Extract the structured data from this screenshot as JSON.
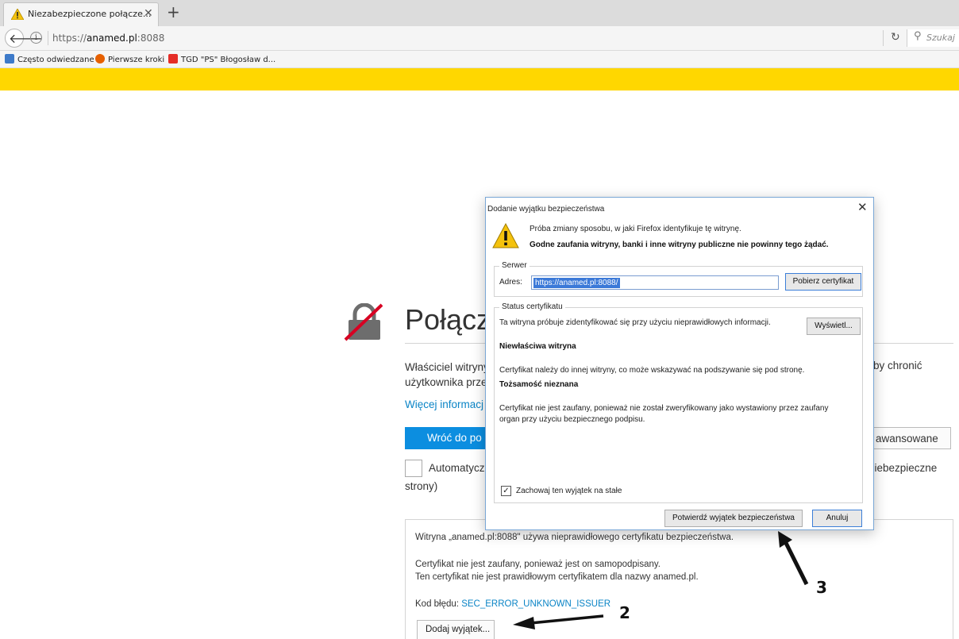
{
  "tab": {
    "title": "Niezabezpieczone połącze..."
  },
  "navbar": {
    "url_prefix": "https://",
    "url_host": "anamed.pl",
    "url_port": ":8088",
    "search_placeholder": "Szukaj"
  },
  "bookmarks": [
    {
      "label": "Często odwiedzane",
      "icon": "bookmark-folder-icon",
      "color": "#3d7ac9"
    },
    {
      "label": "Pierwsze kroki",
      "icon": "firefox-icon",
      "color": "#e66000"
    },
    {
      "label": "TGD \"PS\" Błogosław d...",
      "icon": "youtube-icon",
      "color": "#e52d27"
    }
  ],
  "error_page": {
    "title": "Połącze",
    "desc_line1": "Właściciel witryny",
    "desc_line2": "użytkownika prze",
    "desc_right": "by chronić",
    "more_info": "Więcej informacj",
    "back_button": "Wróć do po",
    "advanced_button": "awansowane",
    "auto_label": "Automatycz",
    "auto_right": "niebezpieczne",
    "auto_cont": "strony)",
    "adv_hidden": "Witryna „anamed.pl:8088\" używa nieprawidłowego certyfikatu bezpieczeństwa.",
    "adv_line1": "Certyfikat nie jest zaufany, ponieważ jest on samopodpisany.",
    "adv_line2": "Ten certyfikat nie jest prawidłowym certyfikatem dla nazwy anamed.pl.",
    "error_code_label": "Kod błędu: ",
    "error_code": "SEC_ERROR_UNKNOWN_ISSUER",
    "add_exception": "Dodaj wyjątek..."
  },
  "dialog": {
    "title": "Dodanie wyjątku bezpieczeństwa",
    "line1": "Próba zmiany sposobu, w jaki Firefox identyfikuje tę witrynę.",
    "line2": "Godne zaufania witryny, banki i inne witryny publiczne nie powinny tego żądać.",
    "server_group": "Serwer",
    "address_label": "Adres:",
    "address_value": "https://anamed.pl:8088/",
    "fetch_button": "Pobierz certyfikat",
    "status_group": "Status certyfikatu",
    "status_intro": "Ta witryna próbuje zidentyfikować się przy użyciu nieprawidłowych informacji.",
    "view_button": "Wyświetl...",
    "wrong_site_title": "Niewłaściwa witryna",
    "wrong_site_text": "Certyfikat należy do innej witryny, co może wskazywać na podszywanie się pod stronę.",
    "unknown_identity_title": "Tożsamość nieznana",
    "unknown_identity_text1": "Certyfikat nie jest zaufany, ponieważ nie został zweryfikowany jako wystawiony przez zaufany",
    "unknown_identity_text2": "organ przy użyciu bezpiecznego podpisu.",
    "permanent_check": "Zachowaj ten wyjątek na stałe",
    "permanent_checked": true,
    "confirm_button": "Potwierdź wyjątek bezpieczeństwa",
    "cancel_button": "Anuluj"
  },
  "annotations": {
    "label_2": "2",
    "label_3": "3"
  },
  "colors": {
    "warning_bar": "#ffd700",
    "link": "#0a84c6",
    "primary_button": "#0c8ee0"
  }
}
